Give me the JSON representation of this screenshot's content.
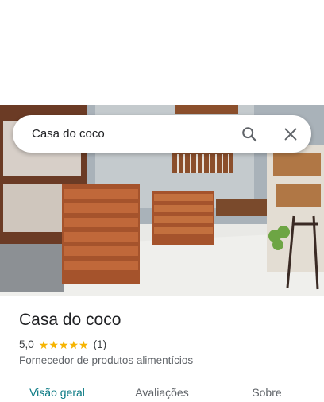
{
  "search": {
    "value": "Casa do coco"
  },
  "place": {
    "name": "Casa do coco",
    "rating": "5,0",
    "stars": 5,
    "review_count": "(1)",
    "category": "Fornecedor de produtos alimentícios"
  },
  "tabs": [
    {
      "label": "Visão geral",
      "active": true
    },
    {
      "label": "Avaliações",
      "active": false
    },
    {
      "label": "Sobre",
      "active": false
    }
  ],
  "colors": {
    "accent": "#0b7a84",
    "star": "#f6b400"
  },
  "icons": {
    "search": "search-icon",
    "close": "close-icon",
    "star": "star-icon"
  }
}
